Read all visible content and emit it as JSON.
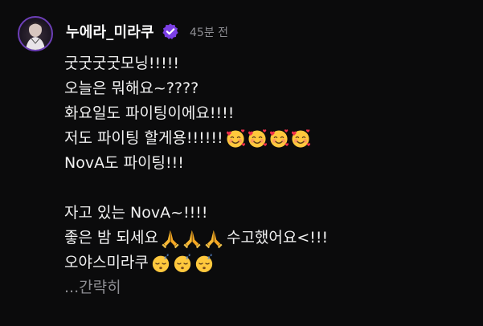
{
  "user": {
    "name": "누에라_미라쿠",
    "verified": true,
    "time": "45분 전",
    "avatar_icon": "user-avatar-photo"
  },
  "post": {
    "line1": "굿굿굿굿모닝!!!!!",
    "line2": "오늘은 뭐해요~????",
    "line3": "화요일도 파이팅이에요!!!!",
    "line4_text": "저도 파이팅 할게용!!!!!!",
    "line4_emoji": "smiling-face-with-hearts-emoji",
    "line4_emoji_count": 4,
    "line5": "NovA도 파이팅!!!",
    "line6": "자고 있는 NovA~!!!!",
    "line7_text_a": "좋은 밤 되세요",
    "line7_emoji": "folded-hands-emoji",
    "line7_emoji_count": 3,
    "line7_text_b": "수고했어요<!!!",
    "line8_text": "오야스미라쿠",
    "line8_emoji": "sleeping-face-emoji",
    "line8_emoji_count": 3,
    "more_label": "...간략히"
  },
  "colors": {
    "background": "#0b0b0c",
    "text": "#f2f2f2",
    "muted": "#8e8e93",
    "verified": "#7b3fe4"
  }
}
